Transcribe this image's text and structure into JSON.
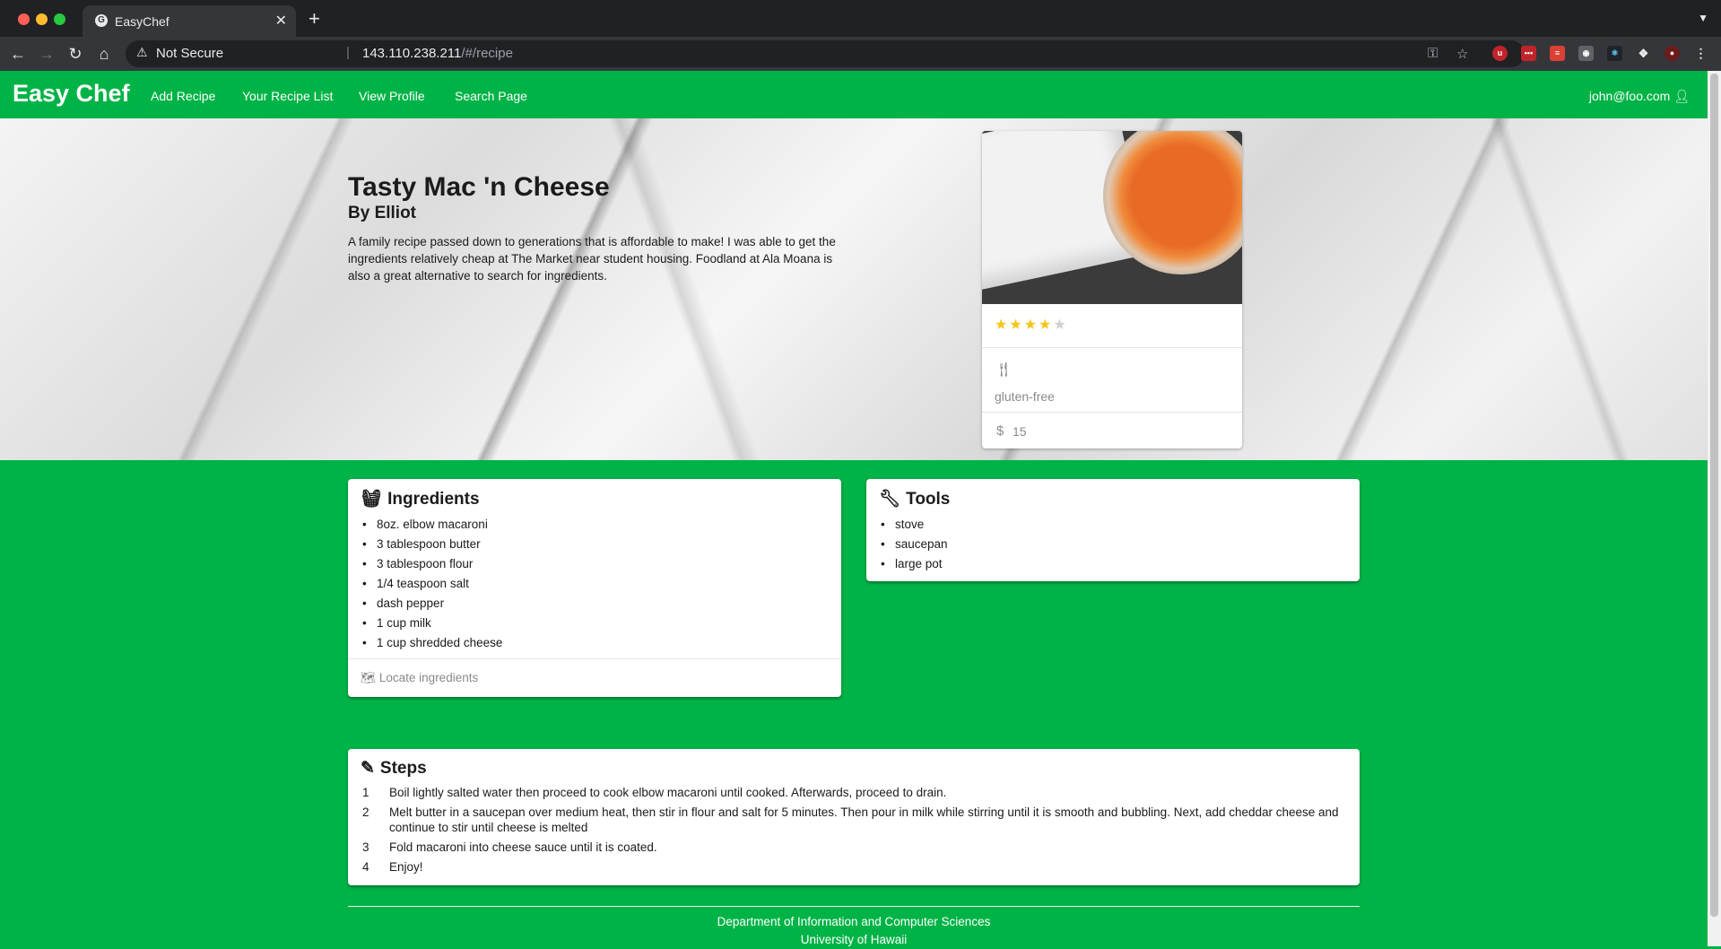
{
  "browser": {
    "tab_title": "EasyChef",
    "tab_favicon": "G",
    "security_label": "Not Secure",
    "url_host": "143.110.238.211",
    "url_path": "/#/recipe",
    "extensions": [
      "ublock-icon",
      "lastpass-icon",
      "todoist-icon",
      "camera-icon",
      "react-devtools-icon",
      "puzzle-icon",
      "profile-avatar"
    ]
  },
  "navbar": {
    "brand": "Easy Chef",
    "links": [
      "Add Recipe",
      "Your Recipe List",
      "View Profile",
      "Search Page"
    ],
    "user": "john@foo.com"
  },
  "recipe": {
    "title": "Tasty Mac 'n Cheese",
    "author": "By Elliot",
    "description": "A family recipe passed down to generations that is affordable to make! I was able to get the ingredients relatively cheap at The Market near student housing. Foodland at Ala Moana is also a great alternative to search for ingredients.",
    "rating": 4,
    "rating_max": 5,
    "diet": "gluten-free",
    "price_symbol": "$",
    "price": "15"
  },
  "ingredients": {
    "heading": "Ingredients",
    "items": [
      "8oz. elbow macaroni",
      "3 tablespoon butter",
      "3 tablespoon flour",
      "1/4 teaspoon salt",
      "dash pepper",
      "1 cup milk",
      "1 cup shredded cheese"
    ],
    "locate_label": "Locate ingredients"
  },
  "tools": {
    "heading": "Tools",
    "items": [
      "stove",
      "saucepan",
      "large pot"
    ]
  },
  "steps": {
    "heading": "Steps",
    "items": [
      "Boil lightly salted water then proceed to cook elbow macaroni until cooked. Afterwards, proceed to drain.",
      "Melt butter in a saucepan over medium heat, then stir in flour and salt for 5 minutes. Then pour in milk while stirring until it is smooth and bubbling. Next, add cheddar cheese and continue to stir until cheese is melted",
      "Fold macaroni into cheese sauce until it is coated.",
      "Enjoy!"
    ]
  },
  "footer": {
    "line1": "Department of Information and Computer Sciences",
    "line2": "University of Hawaii"
  },
  "colors": {
    "brand_green": "#00b346",
    "star": "#f5c518"
  }
}
